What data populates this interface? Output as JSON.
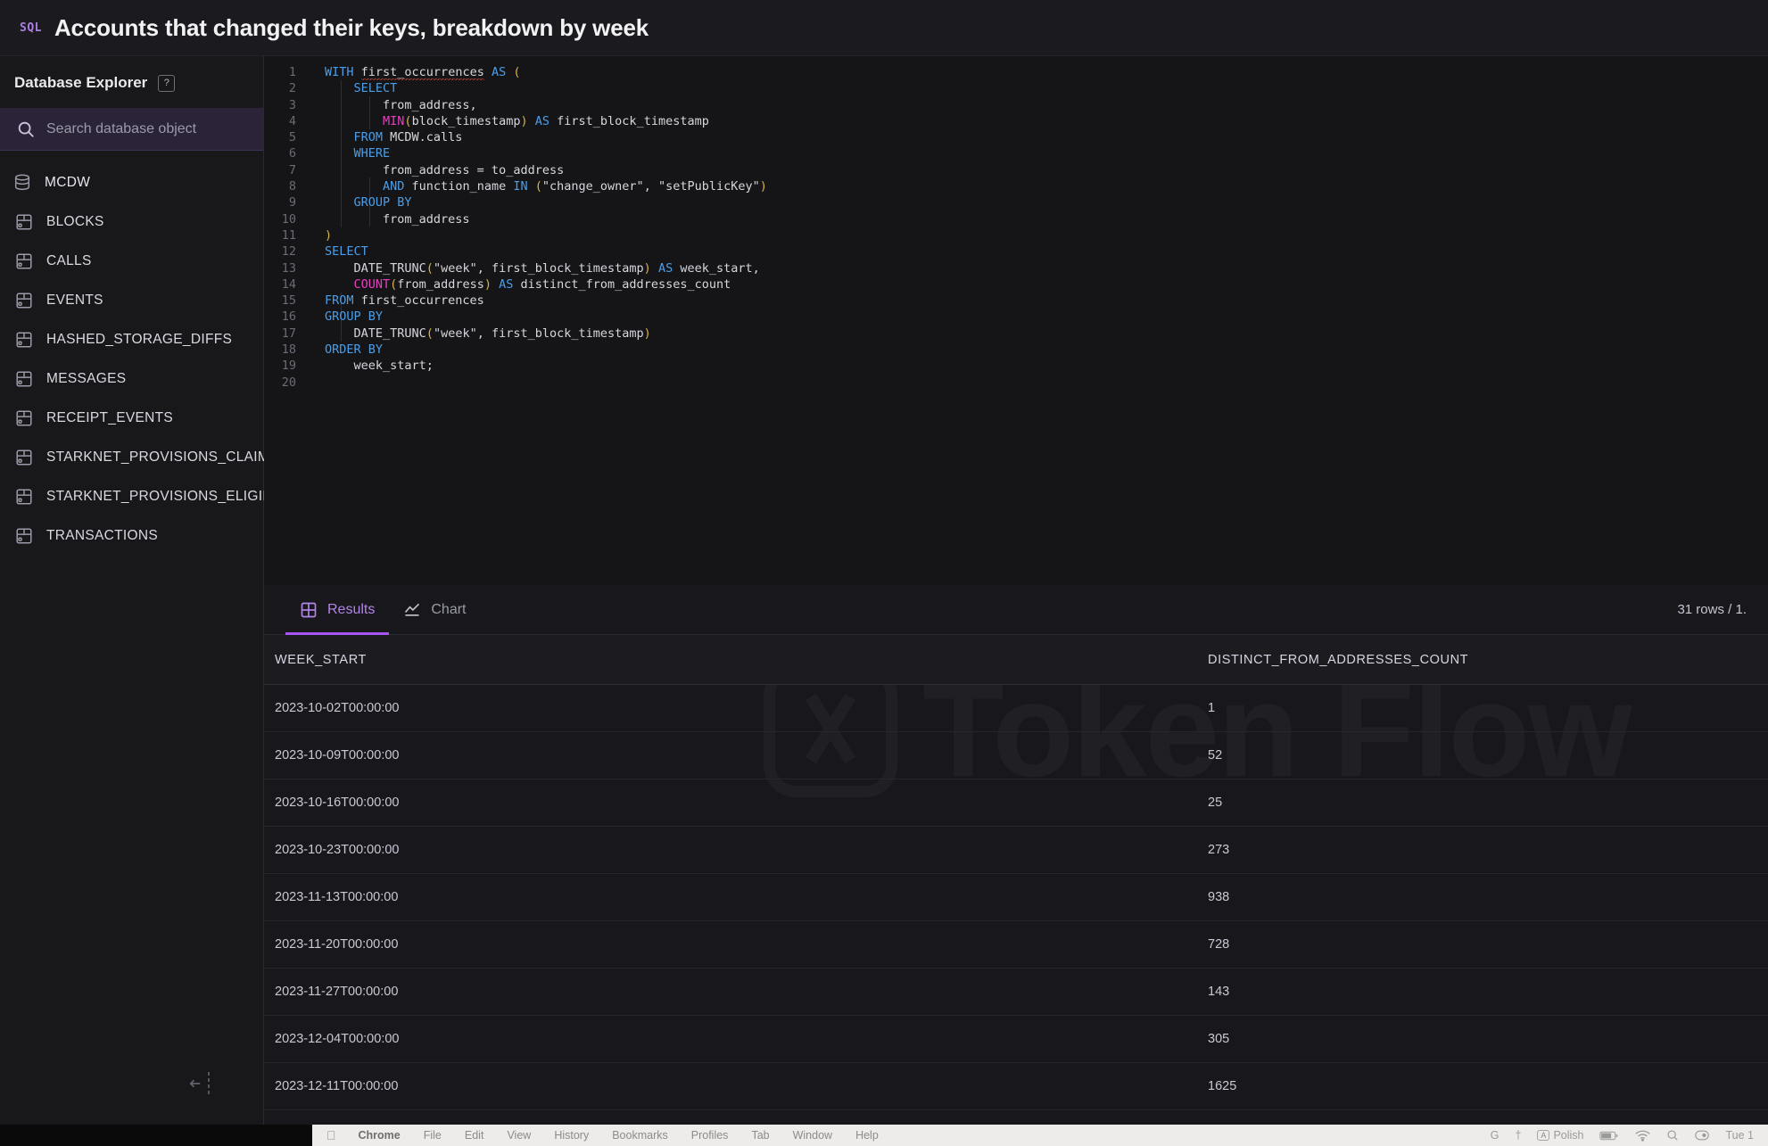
{
  "header": {
    "badge": "SQL",
    "title": "Accounts that changed their keys, breakdown by week"
  },
  "sidebar": {
    "explorer_label": "Database Explorer",
    "help_chip": "?",
    "search": {
      "placeholder": "Search database object",
      "icon": "search-icon"
    },
    "tree": [
      {
        "label": "MCDW",
        "icon": "database-icon",
        "level": 0
      },
      {
        "label": "BLOCKS",
        "icon": "table-icon",
        "level": 1
      },
      {
        "label": "CALLS",
        "icon": "table-icon",
        "level": 1
      },
      {
        "label": "EVENTS",
        "icon": "table-icon",
        "level": 1
      },
      {
        "label": "HASHED_STORAGE_DIFFS",
        "icon": "table-icon",
        "level": 1
      },
      {
        "label": "MESSAGES",
        "icon": "table-icon",
        "level": 1
      },
      {
        "label": "RECEIPT_EVENTS",
        "icon": "table-icon",
        "level": 1
      },
      {
        "label": "STARKNET_PROVISIONS_CLAIMS",
        "icon": "table-icon",
        "level": 1
      },
      {
        "label": "STARKNET_PROVISIONS_ELIGIBILITY",
        "icon": "table-icon",
        "level": 1
      },
      {
        "label": "TRANSACTIONS",
        "icon": "table-icon",
        "level": 1
      }
    ],
    "collapse_icon": "collapse-left-icon"
  },
  "editor": {
    "line_numbers": [
      "1",
      "2",
      "3",
      "4",
      "5",
      "6",
      "7",
      "8",
      "9",
      "10",
      "11",
      "12",
      "13",
      "14",
      "15",
      "16",
      "17",
      "18",
      "19",
      "20"
    ],
    "lines": [
      "WITH first_occurrences AS (",
      "    SELECT",
      "        from_address,",
      "        MIN(block_timestamp) AS first_block_timestamp",
      "    FROM MCDW.calls",
      "    WHERE",
      "        from_address = to_address",
      "        AND function_name IN (\"change_owner\", \"setPublicKey\")",
      "    GROUP BY",
      "        from_address",
      ")",
      "SELECT",
      "    DATE_TRUNC(\"week\", first_block_timestamp) AS week_start,",
      "    COUNT(from_address) AS distinct_from_addresses_count",
      "FROM first_occurrences",
      "GROUP BY",
      "    DATE_TRUNC(\"week\", first_block_timestamp)",
      "ORDER BY",
      "    week_start;",
      ""
    ]
  },
  "results": {
    "tabs": [
      {
        "label": "Results",
        "icon": "grid-icon",
        "active": true
      },
      {
        "label": "Chart",
        "icon": "line-chart-icon",
        "active": false
      }
    ],
    "rows_info": "31 rows / 1.",
    "columns": [
      "WEEK_START",
      "DISTINCT_FROM_ADDRESSES_COUNT"
    ],
    "rows": [
      {
        "week_start": "2023-10-02T00:00:00",
        "count": "1"
      },
      {
        "week_start": "2023-10-09T00:00:00",
        "count": "52"
      },
      {
        "week_start": "2023-10-16T00:00:00",
        "count": "25"
      },
      {
        "week_start": "2023-10-23T00:00:00",
        "count": "273"
      },
      {
        "week_start": "2023-11-13T00:00:00",
        "count": "938"
      },
      {
        "week_start": "2023-11-20T00:00:00",
        "count": "728"
      },
      {
        "week_start": "2023-11-27T00:00:00",
        "count": "143"
      },
      {
        "week_start": "2023-12-04T00:00:00",
        "count": "305"
      },
      {
        "week_start": "2023-12-11T00:00:00",
        "count": "1625"
      }
    ],
    "watermark": "Token Flow"
  },
  "menubar": {
    "apple": "●",
    "items": [
      {
        "label": "Chrome",
        "bold": true
      },
      {
        "label": "File",
        "bold": false
      },
      {
        "label": "Edit",
        "bold": false
      },
      {
        "label": "View",
        "bold": false
      },
      {
        "label": "History",
        "bold": false
      },
      {
        "label": "Bookmarks",
        "bold": false
      },
      {
        "label": "Profiles",
        "bold": false
      },
      {
        "label": "Tab",
        "bold": false
      },
      {
        "label": "Window",
        "bold": false
      },
      {
        "label": "Help",
        "bold": false
      }
    ],
    "status": {
      "grammarly": "G",
      "dagger": "†",
      "input_source_chip": "A",
      "input_source": "Polish",
      "battery_icon": "battery-icon",
      "wifi_icon": "wifi-icon",
      "search_icon": "search-icon",
      "control_center_icon": "control-center-icon",
      "clock": "Tue 1"
    }
  },
  "colors": {
    "accent": "#a855f7",
    "accent_text": "#b185e8",
    "search_bg": "#2b2438"
  }
}
